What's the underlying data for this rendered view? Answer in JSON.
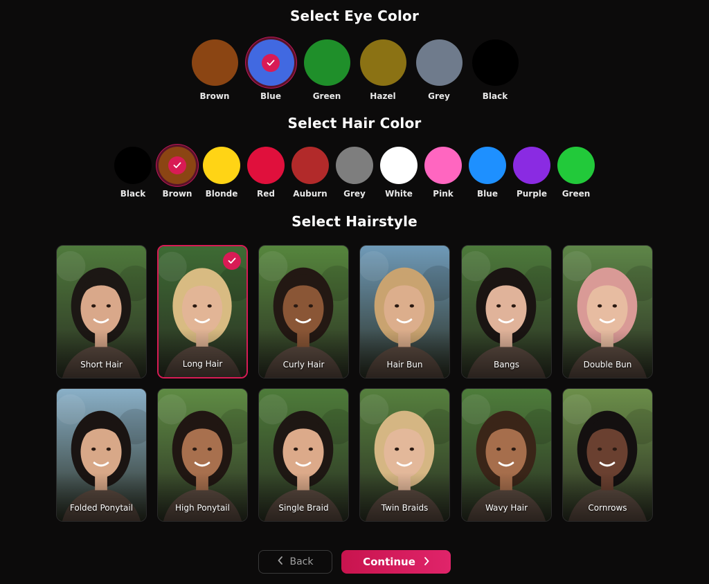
{
  "eye_section": {
    "title": "Select Eye Color",
    "selected": "Blue",
    "options": [
      {
        "label": "Brown",
        "color": "#8b4513"
      },
      {
        "label": "Blue",
        "color": "#4169e1"
      },
      {
        "label": "Green",
        "color": "#1f8f2a"
      },
      {
        "label": "Hazel",
        "color": "#8b7214"
      },
      {
        "label": "Grey",
        "color": "#6f7b8c"
      },
      {
        "label": "Black",
        "color": "#000000"
      }
    ]
  },
  "hair_section": {
    "title": "Select Hair Color",
    "selected": "Brown",
    "options": [
      {
        "label": "Black",
        "color": "#000000"
      },
      {
        "label": "Brown",
        "color": "#8b4513"
      },
      {
        "label": "Blonde",
        "color": "#ffd415"
      },
      {
        "label": "Red",
        "color": "#e0103c"
      },
      {
        "label": "Auburn",
        "color": "#b22a2a"
      },
      {
        "label": "Grey",
        "color": "#7e7e7e"
      },
      {
        "label": "White",
        "color": "#ffffff"
      },
      {
        "label": "Pink",
        "color": "#ff66c0"
      },
      {
        "label": "Blue",
        "color": "#1e90ff"
      },
      {
        "label": "Purple",
        "color": "#8a2be2"
      },
      {
        "label": "Green",
        "color": "#22c93a"
      }
    ]
  },
  "hairstyle_section": {
    "title": "Select Hairstyle",
    "selected": "Long Hair",
    "options": [
      {
        "label": "Short Hair",
        "hair": "#1c1714",
        "skin": "#d9a88a",
        "bg": "#4f7a3c"
      },
      {
        "label": "Long Hair",
        "hair": "#d8bb82",
        "skin": "#e2b596",
        "bg": "#3e6b34"
      },
      {
        "label": "Curly Hair",
        "hair": "#231813",
        "skin": "#8a5636",
        "bg": "#56863d"
      },
      {
        "label": "Hair Bun",
        "hair": "#c9a370",
        "skin": "#dcae8c",
        "bg": "#6f9ab8"
      },
      {
        "label": "Bangs",
        "hair": "#1a1412",
        "skin": "#e0b39a",
        "bg": "#4d7a3b"
      },
      {
        "label": "Double Bun",
        "hair": "#d99a96",
        "skin": "#e7bca1",
        "bg": "#5e8648"
      },
      {
        "label": "Folded Ponytail",
        "hair": "#1a1412",
        "skin": "#d8a888",
        "bg": "#8ab0c8"
      },
      {
        "label": "High Ponytail",
        "hair": "#201612",
        "skin": "#a8704e",
        "bg": "#5f8c44"
      },
      {
        "label": "Single Braid",
        "hair": "#1e1713",
        "skin": "#dcaa8a",
        "bg": "#4e7c3a"
      },
      {
        "label": "Twin Braids",
        "hair": "#d5b683",
        "skin": "#e3b89a",
        "bg": "#56803e"
      },
      {
        "label": "Wavy Hair",
        "hair": "#3a2518",
        "skin": "#a66e4c",
        "bg": "#4e7d3b"
      },
      {
        "label": "Cornrows",
        "hair": "#141010",
        "skin": "#6a4030",
        "bg": "#6c8f4a"
      }
    ]
  },
  "footer": {
    "back_label": "Back",
    "continue_label": "Continue"
  }
}
